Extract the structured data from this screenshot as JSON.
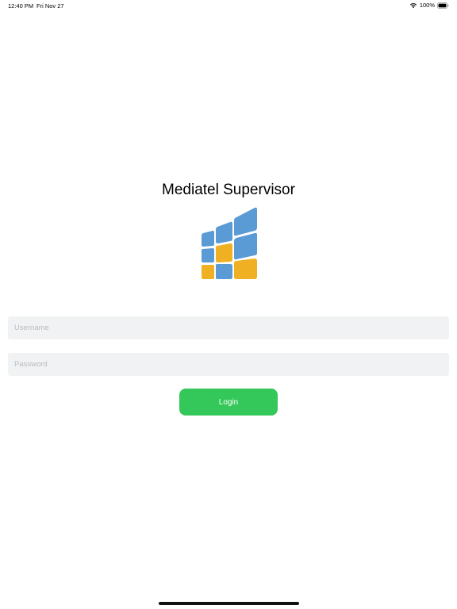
{
  "status_bar": {
    "time": "12:40 PM",
    "date": "Fri Nov 27",
    "battery": "100%",
    "wifi_icon": "wifi-icon",
    "battery_icon": "battery-full-icon"
  },
  "app": {
    "title": "Mediatel Supervisor",
    "logo_icon": "mediatel-logo",
    "logo_colors": {
      "blue": "#5b9bd5",
      "yellow": "#f0b023"
    }
  },
  "login_form": {
    "username_placeholder": "Username",
    "password_placeholder": "Password",
    "login_label": "Login",
    "login_color": "#34c75a"
  }
}
